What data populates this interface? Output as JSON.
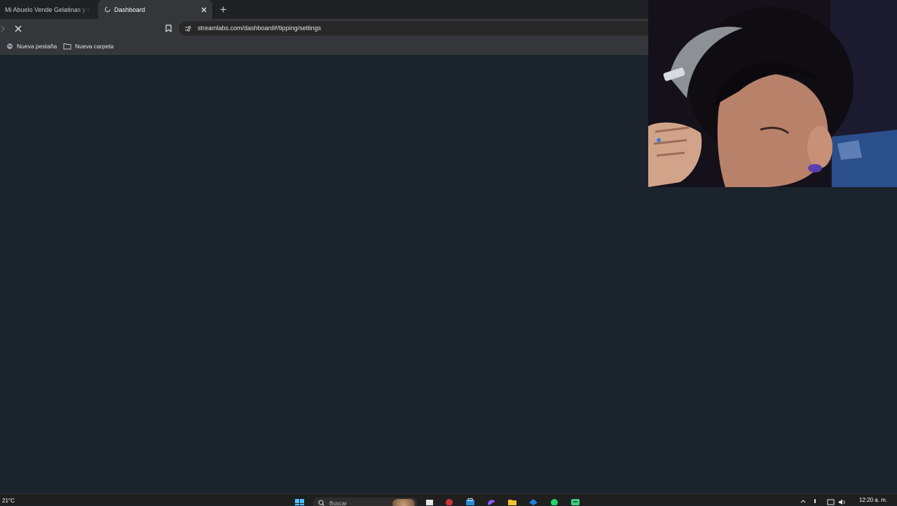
{
  "browser": {
    "tabs": [
      {
        "label": "Mi Abuelo Vende Gelatinas y Dro",
        "active": false
      },
      {
        "label": "Dashboard",
        "active": true
      }
    ],
    "new_tab_icon": "plus-icon",
    "url": "streamlabs.com/dashboard#/tipping/settings",
    "loading": true
  },
  "bookmarks": [
    {
      "label": "Nueva pestaña",
      "icon": "globe-icon"
    },
    {
      "label": "Nueva carpeta",
      "icon": "folder-icon"
    }
  ],
  "page": {
    "background": "#1b242c"
  },
  "webcam": {
    "description_icon": "webcam-feed"
  },
  "taskbar": {
    "weather": "21°C",
    "search_placeholder": "Buscar",
    "pinned_icons": [
      "windows-start-icon",
      "search-icon",
      "task-view-icon",
      "record-icon",
      "store-icon",
      "edge-icon",
      "file-explorer-icon",
      "mail-icon",
      "whatsapp-icon",
      "chat-icon"
    ],
    "tray_icons": [
      "chevron-up-icon",
      "mic-icon",
      "display-icon",
      "volume-icon"
    ],
    "clock": "12:20 a. m."
  },
  "colors": {
    "tabstrip": "#202124",
    "toolbar": "#35363a",
    "page": "#1b242c",
    "taskbar": "#1f1f1f"
  }
}
